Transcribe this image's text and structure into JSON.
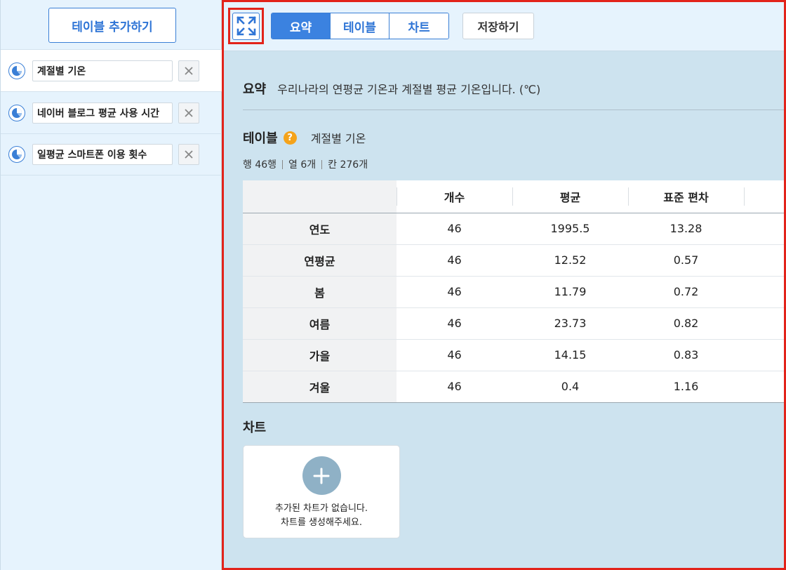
{
  "sidebar": {
    "add_table_label": "테이블 추가하기",
    "items": [
      {
        "name": "계절별 기온",
        "active": true
      },
      {
        "name": "네이버 블로그 평균 사용 시간",
        "active": false
      },
      {
        "name": "일평균 스마트폰 이용 횟수",
        "active": false
      }
    ]
  },
  "toolbar": {
    "tabs": [
      {
        "label": "요약",
        "active": true
      },
      {
        "label": "테이블",
        "active": false
      },
      {
        "label": "차트",
        "active": false
      }
    ],
    "save_label": "저장하기"
  },
  "summary": {
    "title": "요약",
    "text": "우리나라의 연평균 기온과 계절별 평균 기온입니다. (℃)"
  },
  "table_section": {
    "title": "테이블",
    "help_glyph": "?",
    "table_name": "계절별 기온",
    "meta": [
      "행 46행",
      "열 6개",
      "칸 276개"
    ]
  },
  "stats_table": {
    "columns": [
      "",
      "개수",
      "평균",
      "표준 편차",
      ""
    ],
    "rows": [
      {
        "label": "연도",
        "count": "46",
        "mean": "1995.5",
        "std": "13.28"
      },
      {
        "label": "연평균",
        "count": "46",
        "mean": "12.52",
        "std": "0.57"
      },
      {
        "label": "봄",
        "count": "46",
        "mean": "11.79",
        "std": "0.72"
      },
      {
        "label": "여름",
        "count": "46",
        "mean": "23.73",
        "std": "0.82"
      },
      {
        "label": "가을",
        "count": "46",
        "mean": "14.15",
        "std": "0.83"
      },
      {
        "label": "겨울",
        "count": "46",
        "mean": "0.4",
        "std": "1.16"
      }
    ]
  },
  "chart_section": {
    "title": "차트",
    "empty_line1": "추가된 차트가 없습니다.",
    "empty_line2": "차트를 생성해주세요."
  },
  "colors": {
    "accent": "#3b82e0",
    "highlight_border": "#e2231a",
    "help": "#f5a31a",
    "add_circle": "#8fb1c6"
  }
}
